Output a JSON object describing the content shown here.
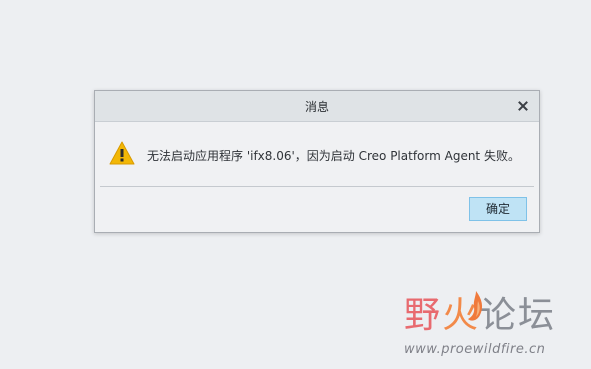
{
  "dialog": {
    "title": "消息",
    "message": "无法启动应用程序 'ifx8.06'，因为启动 Creo Platform Agent 失败。",
    "ok_label": "确定",
    "icon": "warning-icon",
    "close_icon": "close-icon"
  },
  "watermark": {
    "chars": [
      "野",
      "火",
      "论",
      "坛"
    ],
    "url": "www.proewildfire.cn"
  },
  "colors": {
    "titlebar": "#dfe3e6",
    "dialog_bg": "#f0f1f3",
    "ok_button": "#bfe3f5",
    "warning": "#f2b705"
  }
}
